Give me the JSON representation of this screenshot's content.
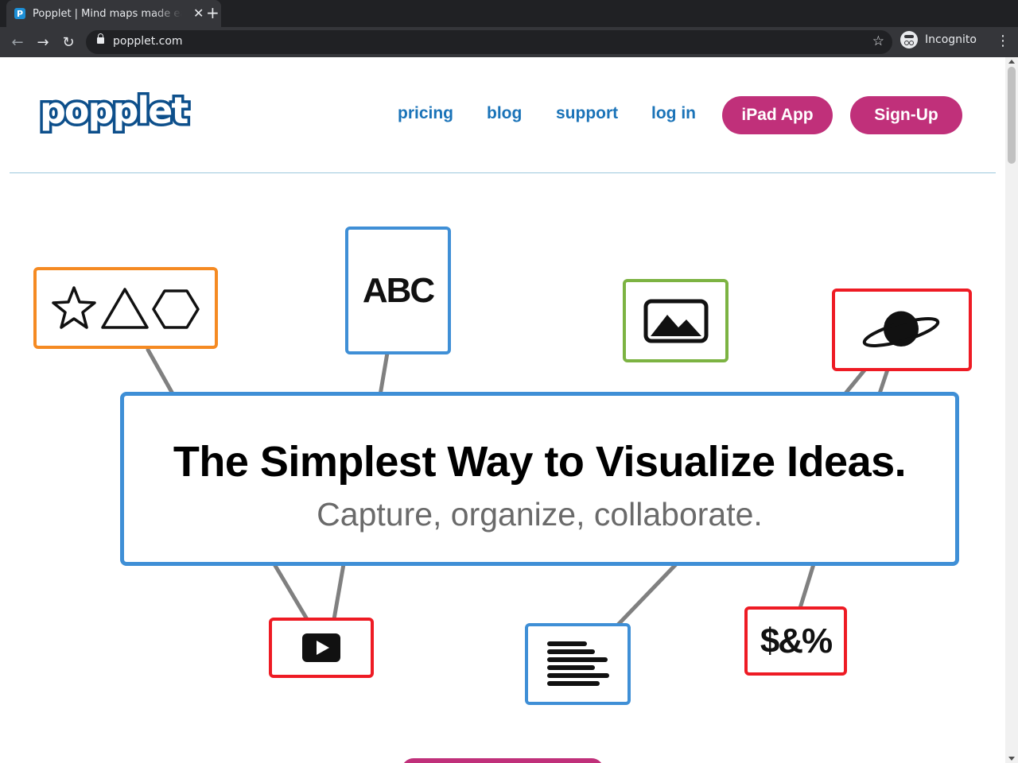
{
  "browser": {
    "tab_title": "Popplet | Mind maps made easy",
    "tab_favicon": "P",
    "url": "popplet.com",
    "profile_label": "Incognito"
  },
  "header": {
    "logo": "popplet",
    "nav": {
      "pricing": "pricing",
      "blog": "blog",
      "support": "support",
      "login": "log in"
    },
    "ipad_app": "iPad App",
    "signup": "Sign-Up"
  },
  "hero": {
    "headline": "The Simplest Way to Visualize Ideas.",
    "subline": "Capture, organize, collaborate.",
    "abc_card": "ABC",
    "symbols_card": "$&%"
  },
  "colors": {
    "brand_blue": "#0d4f8b",
    "link_blue": "#1a73b8",
    "pill_magenta": "#c0307a",
    "card_blue": "#3f8fd6",
    "card_orange": "#f58a22",
    "card_green": "#7cb342",
    "card_red": "#ee1b24"
  }
}
